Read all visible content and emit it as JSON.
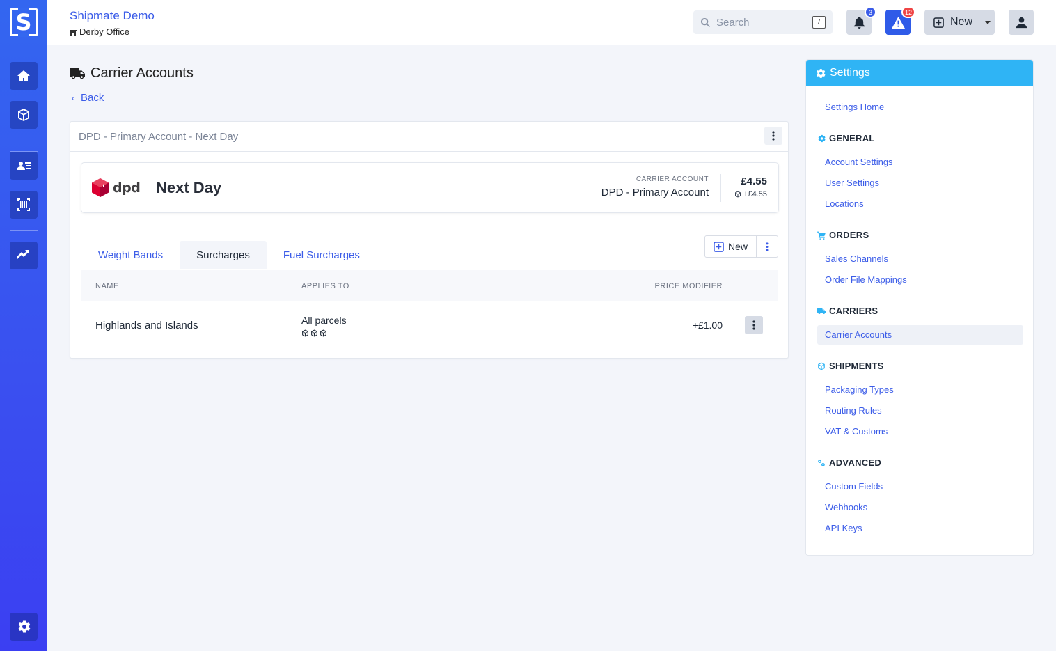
{
  "app": {
    "name": "Shipmate Demo",
    "location": "Derby Office"
  },
  "search": {
    "placeholder": "Search",
    "shortcut": "/"
  },
  "notifications": {
    "count": "3"
  },
  "alerts": {
    "count": "12"
  },
  "header_actions": {
    "new_label": "New"
  },
  "page": {
    "title": "Carrier Accounts",
    "back_label": "Back"
  },
  "service_card": {
    "header": "DPD - Primary Account - Next Day",
    "carrier_logo_text": "dpd",
    "service_name": "Next Day",
    "carrier_account_label": "CARRIER ACCOUNT",
    "carrier_account_name": "DPD - Primary Account",
    "price": "£4.55",
    "price_sub": "+£4.55"
  },
  "tabs": [
    {
      "label": "Weight Bands",
      "active": false
    },
    {
      "label": "Surcharges",
      "active": true
    },
    {
      "label": "Fuel Surcharges",
      "active": false
    }
  ],
  "table_actions": {
    "new_label": "New"
  },
  "table": {
    "headers": {
      "name": "NAME",
      "applies_to": "APPLIES TO",
      "price_modifier": "PRICE MODIFIER"
    },
    "rows": [
      {
        "name": "Highlands and Islands",
        "applies_to": "All parcels",
        "price_modifier": "+£1.00"
      }
    ]
  },
  "settings": {
    "title": "Settings",
    "home": "Settings Home",
    "sections": [
      {
        "title": "GENERAL",
        "icon": "gear-icon",
        "links": [
          "Account Settings",
          "User Settings",
          "Locations"
        ]
      },
      {
        "title": "ORDERS",
        "icon": "cart-icon",
        "links": [
          "Sales Channels",
          "Order File Mappings"
        ]
      },
      {
        "title": "CARRIERS",
        "icon": "truck-icon",
        "links": [
          "Carrier Accounts"
        ]
      },
      {
        "title": "SHIPMENTS",
        "icon": "box-icon",
        "links": [
          "Packaging Types",
          "Routing Rules",
          "VAT & Customs"
        ]
      },
      {
        "title": "ADVANCED",
        "icon": "cogs-icon",
        "links": [
          "Custom Fields",
          "Webhooks",
          "API Keys"
        ]
      }
    ],
    "active_link": "Carrier Accounts"
  },
  "colors": {
    "sidebar": "#3a55f0",
    "accent": "#3b5ce8",
    "settings_header": "#2fb4f5",
    "alert": "#2f5be8",
    "badge_red": "#ef4444"
  }
}
